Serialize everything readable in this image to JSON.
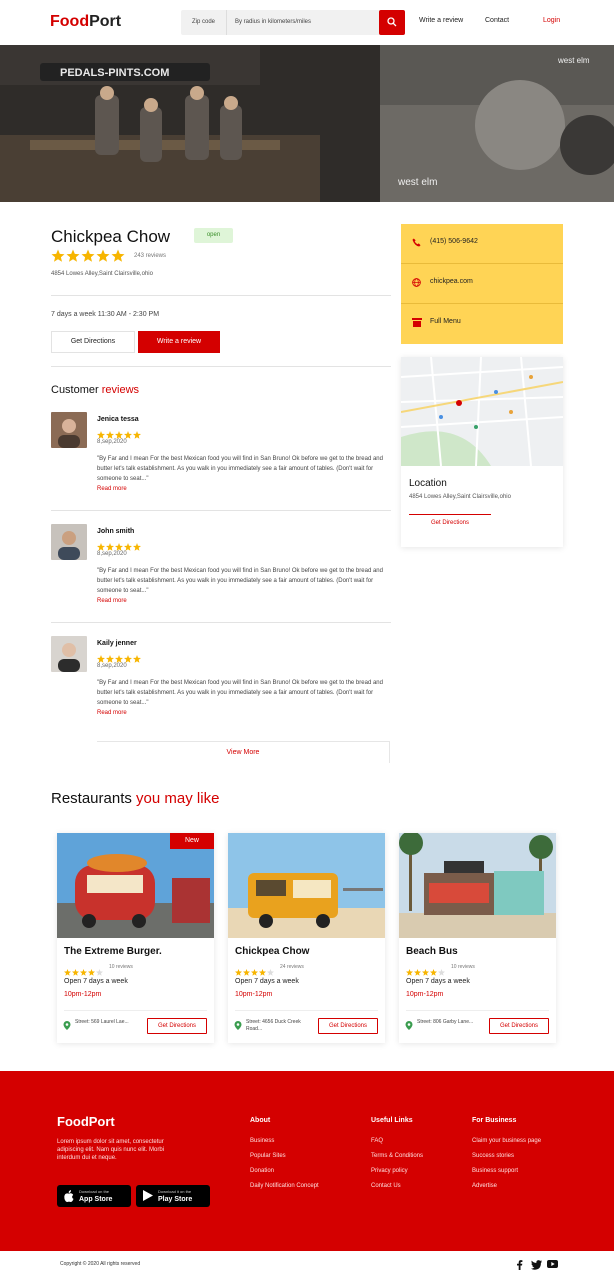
{
  "header": {
    "logo_part1": "Food",
    "logo_part2": "Port",
    "zip_placeholder": "Zip code",
    "radius_placeholder": "By radius in kilometers/miles",
    "nav_write_review": "Write a review",
    "nav_contact": "Contact",
    "nav_login": "Login"
  },
  "restaurant": {
    "name": "Chickpea Chow",
    "status": "open",
    "rating": 5,
    "review_count": "243 reviews",
    "address": "4854 Lowes Alley,Saint Clairsville,ohio",
    "hours": "7 days a week  11:30 AM - 2:30 PM",
    "get_directions_label": "Get Directions",
    "write_review_label": "Write a review"
  },
  "info": {
    "phone": "(415) 506-9642",
    "website": "chickpea.com",
    "menu": "Full Menu"
  },
  "location": {
    "title": "Location",
    "address": "4854 Lowes Alley,Saint Clairsville,ohio",
    "button_label": "Get Directions"
  },
  "reviews_section": {
    "title_part1": "Customer",
    "title_part2": "reviews",
    "view_more": "View More",
    "items": [
      {
        "name": "Jenica tessa",
        "date": "8,sep,2020",
        "rating": 5,
        "text": "\"By Far and I mean For the best Mexican food you will find in San Bruno! Ok before we get to the bread and butter let's talk establishment. As you walk in you immediately see a fair amount of tables. (Don't wait for someone to seat...\"",
        "read_more": "Read more"
      },
      {
        "name": "John smith",
        "date": "8,sep,2020",
        "rating": 5,
        "text": "\"By Far and I mean For the best Mexican food you will find in San Bruno! Ok before we get to the bread and butter let's talk establishment. As you walk in you immediately see a fair amount of tables. (Don't wait for someone to seat...\"",
        "read_more": "Read more"
      },
      {
        "name": "Kaily jenner",
        "date": "8,sep,2020",
        "rating": 5,
        "text": "\"By Far and I mean For the best Mexican food you will find in San Bruno! Ok before we get to the bread and butter let's talk establishment. As you walk in you immediately see a fair amount of tables. (Don't wait for someone to seat...\"",
        "read_more": "Read more"
      }
    ]
  },
  "likes_section": {
    "title_part1": "Restaurants",
    "title_part2": "you may like",
    "cards": [
      {
        "name": "The Extreme Burger.",
        "badge": "New",
        "rating": 4,
        "reviews": "10 reviews",
        "open_text": "Open 7 days a week",
        "time": "10pm-12pm",
        "street": "Street: 569 Laurel Lae...",
        "button": "Get Directions"
      },
      {
        "name": "Chickpea Chow",
        "badge": "",
        "rating": 4,
        "reviews": "24 reviews",
        "open_text": "Open 7 days a week",
        "time": "10pm-12pm",
        "street": "Street: 4656 Duck Creek Road...",
        "button": "Get Directions"
      },
      {
        "name": "Beach Bus",
        "badge": "",
        "rating": 4,
        "reviews": "10 reviews",
        "open_text": "Open 7 days a week",
        "time": "10pm-12pm",
        "street": "Street: 806 Garby Lane...",
        "button": "Get Directions"
      }
    ]
  },
  "footer": {
    "logo": "FoodPort",
    "description": "Lorem ipsum dolor sit amet, consectetur adipiscing elit. Nam quis nunc elit. Morbi interdum dui et neque.",
    "app_store_top": "Download on the",
    "app_store_name": "App Store",
    "play_store_top": "Download it on the",
    "play_store_name": "Play Store",
    "columns": [
      {
        "title": "About",
        "items": [
          "Business",
          "Popular Sites",
          "Donation",
          "Daily Notification Concept"
        ]
      },
      {
        "title": "Useful Links",
        "items": [
          "FAQ",
          "Terms & Conditions",
          "Privacy policy",
          "Contact Us"
        ]
      },
      {
        "title": "For Business",
        "items": [
          "Claim your business page",
          "Success stories",
          "Business support",
          "Advertise"
        ]
      }
    ],
    "copyright": "Copyright © 2020 All rights reserved"
  },
  "colors": {
    "accent": "#d40000",
    "info_yellow": "#ffd455",
    "open_green": "#dff5d8"
  }
}
